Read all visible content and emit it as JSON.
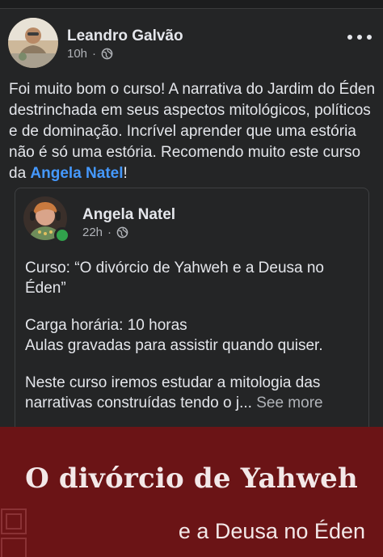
{
  "post": {
    "author": "Leandro Galvão",
    "time": "10h",
    "separator": "·",
    "privacy_icon": "globe-icon",
    "more_icon": "more-dots-icon",
    "text_before_mention": "Foi muito bom o curso! A narrativa do Jardim do Éden destrinchada em seus aspectos mitológicos, políticos e de dominação. Incrível aprender que uma estória não é só uma estória. Recomendo muito este curso da ",
    "mention": "Angela Natel",
    "text_after_mention": "!"
  },
  "shared": {
    "author": "Angela Natel",
    "time": "22h",
    "separator": "·",
    "privacy_icon": "globe-icon",
    "online_status_color": "#31a24c",
    "para1": "Curso: “O divórcio de Yahweh e a Deusa no Éden”",
    "para2_line1": "Carga horária: 10 horas",
    "para2_line2": "Aulas gravadas para assistir quando quiser.",
    "para3": "Neste curso iremos estudar a mitologia das narrativas construídas tendo o j...",
    "see_more": "See more"
  },
  "banner": {
    "title": "O divórcio de Yahweh",
    "subtitle": "e a Deusa no Éden",
    "background_color": "#6b1416"
  },
  "colors": {
    "background": "#242526",
    "text": "#e4e6eb",
    "secondary_text": "#b0b3b8",
    "mention": "#4599ff"
  }
}
